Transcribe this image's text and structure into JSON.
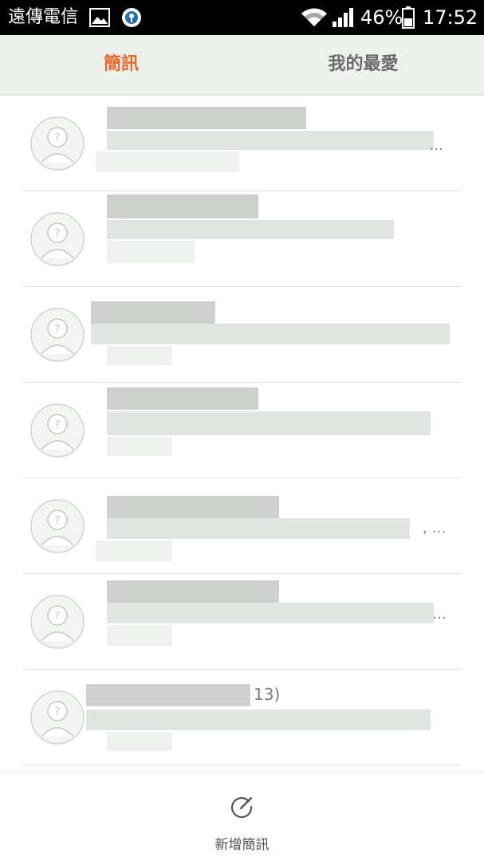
{
  "status_bar": {
    "carrier": "遠傳電信",
    "battery": "46%",
    "time": "17:52",
    "icons": [
      "image-icon",
      "circle-app-icon",
      "wifi-icon",
      "signal-icon",
      "battery-icon"
    ]
  },
  "tabs": [
    {
      "label": "簡訊",
      "active": true
    },
    {
      "label": "我的最愛",
      "active": false
    }
  ],
  "colors": {
    "accent": "#e8692c",
    "tab_bg": "#ecf1ec",
    "inactive_tab": "#6a6a6a"
  },
  "conversations": [
    {
      "name": "",
      "preview": "…"
    },
    {
      "name": "",
      "preview": ""
    },
    {
      "name": "",
      "preview": ""
    },
    {
      "name": "",
      "preview": ""
    },
    {
      "name": "",
      "preview": ", …"
    },
    {
      "name": "",
      "preview": "…"
    },
    {
      "name": "13)",
      "preview": ""
    }
  ],
  "bottom": {
    "compose_label": "新增簡訊"
  }
}
